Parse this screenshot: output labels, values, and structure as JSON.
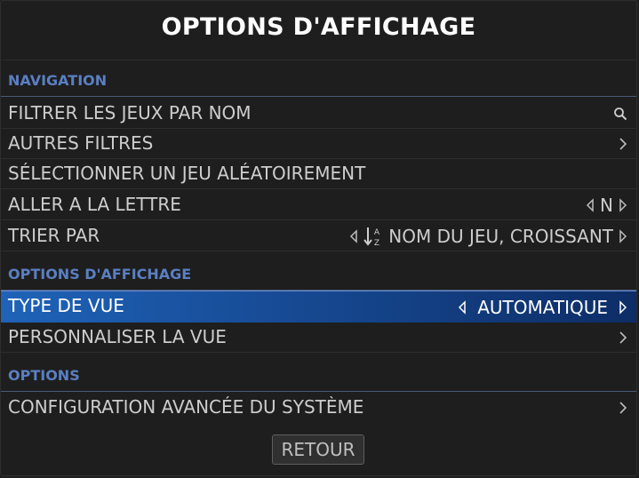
{
  "window": {
    "title": "OPTIONS D'AFFICHAGE"
  },
  "sections": {
    "navigation": "NAVIGATION",
    "display": "OPTIONS D'AFFICHAGE",
    "options": "OPTIONS"
  },
  "rows": {
    "filter_by_name": {
      "label": "FILTRER LES JEUX PAR NOM",
      "icon": "search-icon"
    },
    "other_filters": {
      "label": "AUTRES FILTRES",
      "icon": "chevron-right-icon"
    },
    "random_game": {
      "label": "SÉLECTIONNER UN JEU ALÉATOIREMENT"
    },
    "jump_to_letter": {
      "label": "ALLER A LA LETTRE",
      "value": "N"
    },
    "sort_by": {
      "label": "TRIER PAR",
      "value": "NOM DU JEU, CROISSANT",
      "icon": "sort-az-icon"
    },
    "view_type": {
      "label": "TYPE DE VUE",
      "value": "AUTOMATIQUE"
    },
    "customize_view": {
      "label": "PERSONNALISER LA VUE",
      "icon": "chevron-right-icon"
    },
    "advanced_config": {
      "label": "CONFIGURATION AVANCÉE DU SYSTÈME",
      "icon": "chevron-right-icon"
    }
  },
  "buttons": {
    "back": "RETOUR"
  },
  "colors": {
    "background": "#1f1f1f",
    "section_label": "#5a7fc2",
    "selection_start": "#1f63b8",
    "selection_end": "#0d2d66"
  }
}
